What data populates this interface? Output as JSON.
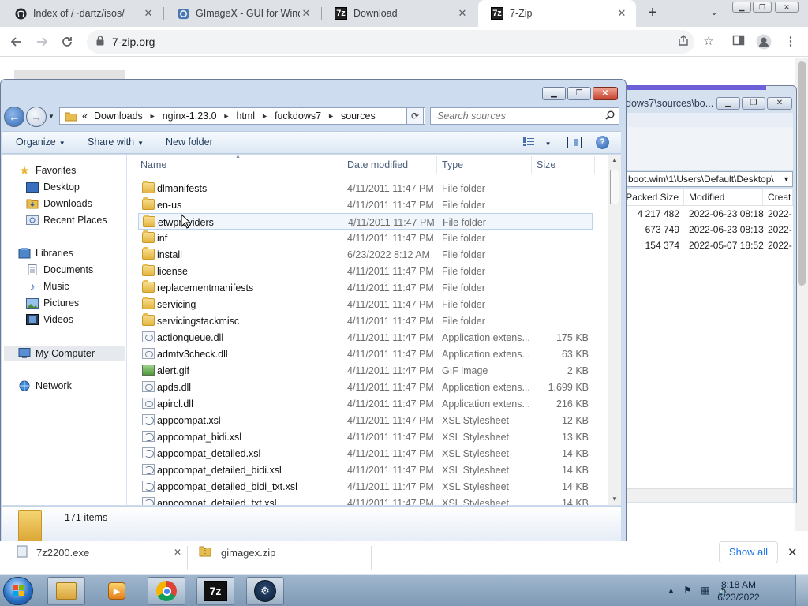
{
  "browser": {
    "tabs": [
      {
        "title": "Index of /~dartz/isos/",
        "icon": "github-octocat-icon"
      },
      {
        "title": "GImageX - GUI for Windo",
        "icon": "gimagex-icon"
      },
      {
        "title": "Download",
        "icon": "sevenzip-icon",
        "favicon_text": "7z"
      },
      {
        "title": "7-Zip",
        "icon": "sevenzip-icon",
        "favicon_text": "7z"
      }
    ],
    "active_tab": 3,
    "new_tab": "+",
    "url": "7-zip.org",
    "download_shelf": {
      "items": [
        {
          "name": "7z2200.exe"
        },
        {
          "name": "gimagex.zip"
        }
      ],
      "show_all": "Show all"
    }
  },
  "sevenzip_window": {
    "title": "dows7\\sources\\bo...",
    "address": "boot.wim\\1\\Users\\Default\\Desktop\\",
    "columns": [
      "Packed Size",
      "Modified",
      "Creat"
    ],
    "rows": [
      {
        "packed": "4 217 482",
        "modified": "2022-06-23 08:18",
        "created": "2022-"
      },
      {
        "packed": "673 749",
        "modified": "2022-06-23 08:13",
        "created": "2022-"
      },
      {
        "packed": "154 374",
        "modified": "2022-05-07 18:52",
        "created": "2022-"
      }
    ]
  },
  "explorer": {
    "breadcrumb": [
      "Downloads",
      "nginx-1.23.0",
      "html",
      "fuckdows7",
      "sources"
    ],
    "breadcrumb_overflow": "«",
    "search_placeholder": "Search sources",
    "commands": {
      "organize": "Organize",
      "share_with": "Share with",
      "new_folder": "New folder",
      "help": "?"
    },
    "nav": {
      "favorites": "Favorites",
      "desktop": "Desktop",
      "downloads": "Downloads",
      "recent_places": "Recent Places",
      "libraries": "Libraries",
      "documents": "Documents",
      "music": "Music",
      "pictures": "Pictures",
      "videos": "Videos",
      "my_computer": "My Computer",
      "network": "Network"
    },
    "columns": {
      "name": "Name",
      "date": "Date modified",
      "type": "Type",
      "size": "Size"
    },
    "files": [
      {
        "name": "dlmanifests",
        "date": "4/11/2011 11:47 PM",
        "type": "File folder",
        "size": "",
        "icon": "folder"
      },
      {
        "name": "en-us",
        "date": "4/11/2011 11:47 PM",
        "type": "File folder",
        "size": "",
        "icon": "folder"
      },
      {
        "name": "etwproviders",
        "date": "4/11/2011 11:47 PM",
        "type": "File folder",
        "size": "",
        "icon": "folder"
      },
      {
        "name": "inf",
        "date": "4/11/2011 11:47 PM",
        "type": "File folder",
        "size": "",
        "icon": "folder"
      },
      {
        "name": "install",
        "date": "6/23/2022 8:12 AM",
        "type": "File folder",
        "size": "",
        "icon": "folder"
      },
      {
        "name": "license",
        "date": "4/11/2011 11:47 PM",
        "type": "File folder",
        "size": "",
        "icon": "folder"
      },
      {
        "name": "replacementmanifests",
        "date": "4/11/2011 11:47 PM",
        "type": "File folder",
        "size": "",
        "icon": "folder"
      },
      {
        "name": "servicing",
        "date": "4/11/2011 11:47 PM",
        "type": "File folder",
        "size": "",
        "icon": "folder"
      },
      {
        "name": "servicingstackmisc",
        "date": "4/11/2011 11:47 PM",
        "type": "File folder",
        "size": "",
        "icon": "folder"
      },
      {
        "name": "actionqueue.dll",
        "date": "4/11/2011 11:47 PM",
        "type": "Application extens...",
        "size": "175 KB",
        "icon": "dll"
      },
      {
        "name": "admtv3check.dll",
        "date": "4/11/2011 11:47 PM",
        "type": "Application extens...",
        "size": "63 KB",
        "icon": "dll"
      },
      {
        "name": "alert.gif",
        "date": "4/11/2011 11:47 PM",
        "type": "GIF image",
        "size": "2 KB",
        "icon": "gif"
      },
      {
        "name": "apds.dll",
        "date": "4/11/2011 11:47 PM",
        "type": "Application extens...",
        "size": "1,699 KB",
        "icon": "dll"
      },
      {
        "name": "apircl.dll",
        "date": "4/11/2011 11:47 PM",
        "type": "Application extens...",
        "size": "216 KB",
        "icon": "dll"
      },
      {
        "name": "appcompat.xsl",
        "date": "4/11/2011 11:47 PM",
        "type": "XSL Stylesheet",
        "size": "12 KB",
        "icon": "xsl"
      },
      {
        "name": "appcompat_bidi.xsl",
        "date": "4/11/2011 11:47 PM",
        "type": "XSL Stylesheet",
        "size": "13 KB",
        "icon": "xsl"
      },
      {
        "name": "appcompat_detailed.xsl",
        "date": "4/11/2011 11:47 PM",
        "type": "XSL Stylesheet",
        "size": "14 KB",
        "icon": "xsl"
      },
      {
        "name": "appcompat_detailed_bidi.xsl",
        "date": "4/11/2011 11:47 PM",
        "type": "XSL Stylesheet",
        "size": "14 KB",
        "icon": "xsl"
      },
      {
        "name": "appcompat_detailed_bidi_txt.xsl",
        "date": "4/11/2011 11:47 PM",
        "type": "XSL Stylesheet",
        "size": "14 KB",
        "icon": "xsl"
      },
      {
        "name": "appcompat_detailed_txt.xsl",
        "date": "4/11/2011 11:47 PM",
        "type": "XSL Stylesheet",
        "size": "14 KB",
        "icon": "xsl"
      }
    ],
    "hover_index": 2,
    "item_count": "171 items"
  },
  "taskbar": {
    "apps": [
      "windows-explorer",
      "windows-media-player",
      "google-chrome",
      "7-zip",
      "steam"
    ],
    "clock_time": "8:18 AM",
    "clock_date": "6/23/2022",
    "sevenzip_label": "7z"
  }
}
